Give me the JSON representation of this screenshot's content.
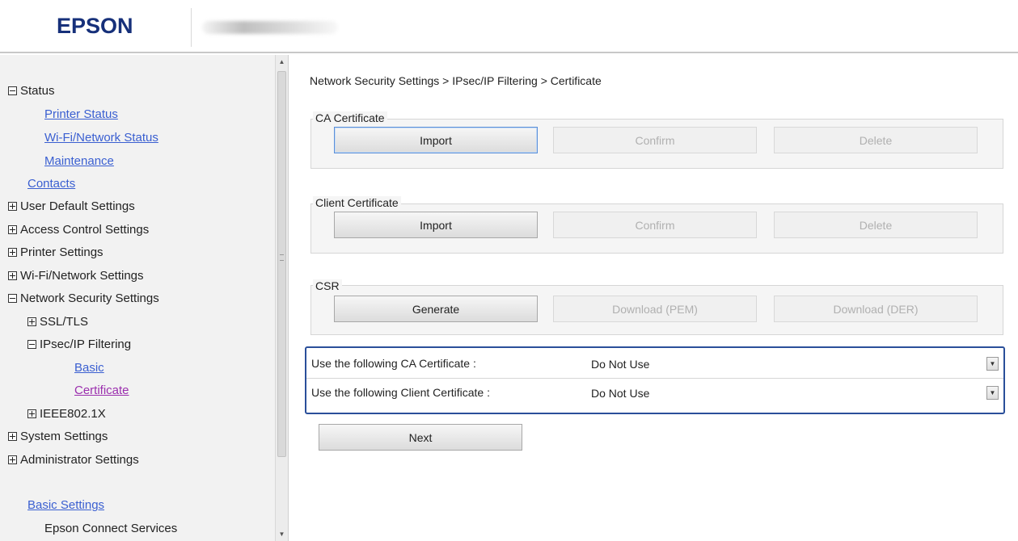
{
  "header": {
    "logo": "EPSON"
  },
  "sidebar": {
    "status": "Status",
    "printer_status": "Printer Status",
    "wifi_network_status": "Wi-Fi/Network Status",
    "maintenance": "Maintenance",
    "contacts": "Contacts",
    "user_default_settings": "User Default Settings",
    "access_control_settings": "Access Control Settings",
    "printer_settings": "Printer Settings",
    "wifi_network_settings": "Wi-Fi/Network Settings",
    "network_security_settings": "Network Security Settings",
    "ssl_tls": "SSL/TLS",
    "ipsec_ip_filtering": "IPsec/IP Filtering",
    "basic": "Basic",
    "certificate": "Certificate",
    "ieee8021x": "IEEE802.1X",
    "system_settings": "System Settings",
    "administrator_settings": "Administrator Settings",
    "basic_settings": "Basic Settings",
    "epson_connect_services": "Epson Connect Services"
  },
  "main": {
    "breadcrumb": "Network Security Settings > IPsec/IP Filtering > Certificate",
    "ca_certificate": {
      "legend": "CA Certificate",
      "import": "Import",
      "confirm": "Confirm",
      "delete": "Delete"
    },
    "client_certificate": {
      "legend": "Client Certificate",
      "import": "Import",
      "confirm": "Confirm",
      "delete": "Delete"
    },
    "csr": {
      "legend": "CSR",
      "generate": "Generate",
      "download_pem": "Download (PEM)",
      "download_der": "Download (DER)"
    },
    "use_ca_label": "Use the following CA Certificate :",
    "use_ca_value": "Do Not Use",
    "use_client_label": "Use the following Client Certificate :",
    "use_client_value": "Do Not Use",
    "next": "Next"
  },
  "colors": {
    "brand": "#16307a",
    "link": "#3a5fd1",
    "visited_link": "#9b2fae",
    "selection_border": "#2a4f9a"
  }
}
